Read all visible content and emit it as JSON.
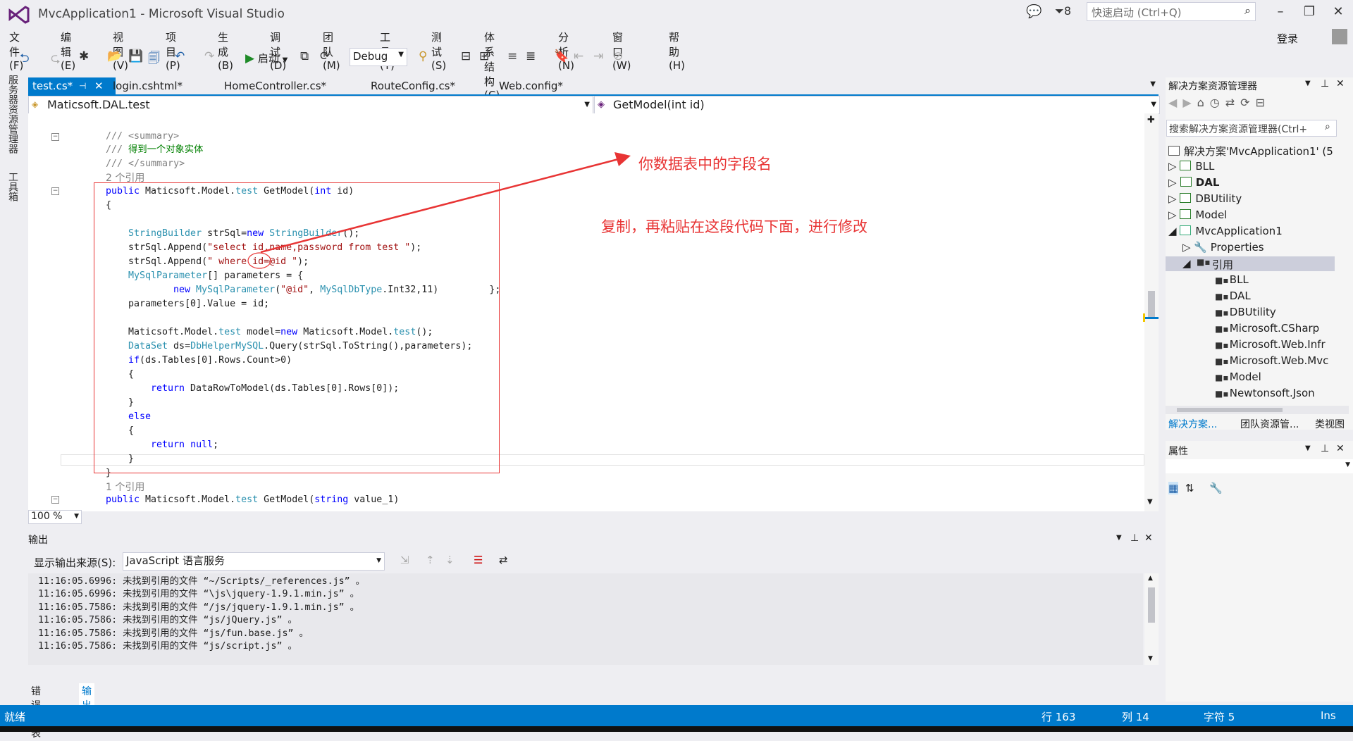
{
  "window": {
    "title": "MvcApplication1 - Microsoft Visual Studio",
    "notification_count": "8",
    "quick_launch_placeholder": "快速启动 (Ctrl+Q)",
    "login": "登录"
  },
  "menu": [
    "文件(F)",
    "编辑(E)",
    "视图(V)",
    "项目(P)",
    "生成(B)",
    "调试(D)",
    "团队(M)",
    "工具(T)",
    "测试(S)",
    "体系结构(C)",
    "分析(N)",
    "窗口(W)",
    "帮助(H)"
  ],
  "toolbar": {
    "start_label": "启动",
    "config": "Debug"
  },
  "left_strip": {
    "server_explorer": "服务器资源管理器",
    "toolbox": "工具箱"
  },
  "tabs": [
    {
      "label": "test.cs*",
      "active": true
    },
    {
      "label": "login.cshtml*"
    },
    {
      "label": "HomeController.cs*"
    },
    {
      "label": "RouteConfig.cs*"
    },
    {
      "label": "Web.config*"
    }
  ],
  "nav": {
    "class": "Maticsoft.DAL.test",
    "member": "GetModel(int id)"
  },
  "code": {
    "ref_count_2": "2 个引用",
    "ref_count_1": "1 个引用",
    "summary_open": "/// <summary>",
    "summary_text": "/// 得到一个对象实体",
    "summary_close": "/// </summary>"
  },
  "annotations": {
    "field_name": "你数据表中的字段名",
    "instruction": "复制，再粘贴在这段代码下面，进行修改"
  },
  "zoom": "100 %",
  "output": {
    "title": "输出",
    "source_label": "显示输出来源(S):",
    "source_value": "JavaScript 语言服务",
    "lines": [
      "11:16:05.6996: 未找到引用的文件 “~/Scripts/_references.js” 。",
      "11:16:05.6996: 未找到引用的文件 “\\js\\jquery-1.9.1.min.js” 。",
      "11:16:05.7586: 未找到引用的文件 “/js/jquery-1.9.1.min.js” 。",
      "11:16:05.7586: 未找到引用的文件 “js/jQuery.js” 。",
      "11:16:05.7586: 未找到引用的文件 “js/fun.base.js” 。",
      "11:16:05.7586: 未找到引用的文件 “js/script.js” 。"
    ]
  },
  "bottom_tabs": [
    "错误列表",
    "输出"
  ],
  "solution_explorer": {
    "title": "解决方案资源管理器",
    "search_placeholder": "搜索解决方案资源管理器(Ctrl+",
    "solution": "解决方案'MvcApplication1' (5",
    "projects": [
      "BLL",
      "DAL",
      "DBUtility",
      "Model",
      "MvcApplication1"
    ],
    "properties": "Properties",
    "references_label": "引用",
    "references": [
      "BLL",
      "DAL",
      "DBUtility",
      "Microsoft.CSharp",
      "Microsoft.Web.Infr",
      "Microsoft.Web.Mvc",
      "Model",
      "Newtonsoft.Json"
    ],
    "bottom_tabs": [
      "解决方案...",
      "团队资源管...",
      "类视图"
    ]
  },
  "properties_panel": {
    "title": "属性"
  },
  "status": {
    "ready": "就绪",
    "line": "行 163",
    "col": "列 14",
    "char": "字符 5",
    "ins": "Ins"
  }
}
